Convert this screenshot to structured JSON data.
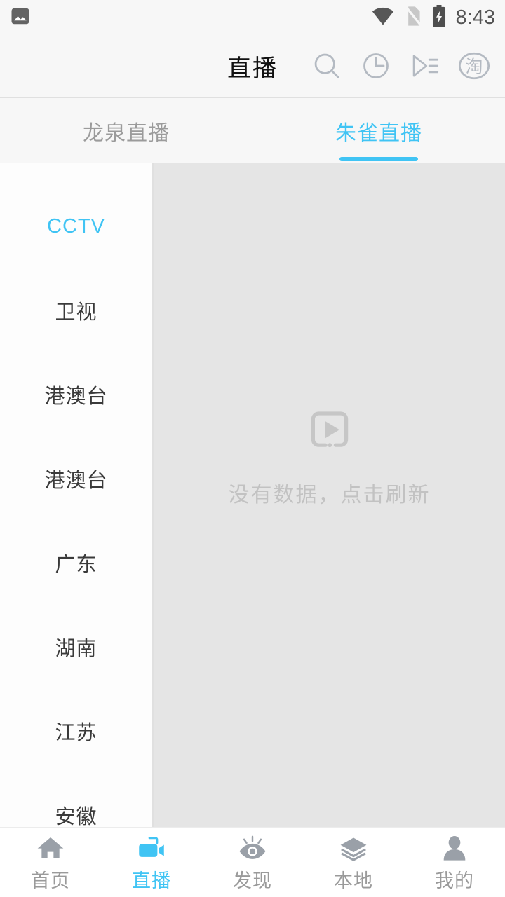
{
  "statusbar": {
    "notification_icon": "image-icon",
    "wifi_icon": "wifi-icon",
    "sim_icon": "no-sim-icon",
    "battery_icon": "battery-charging-icon",
    "time": "8:43"
  },
  "titlebar": {
    "title": "直播",
    "actions": [
      {
        "name": "search-icon",
        "label": "搜索"
      },
      {
        "name": "history-clock-icon",
        "label": "历史"
      },
      {
        "name": "playlist-icon",
        "label": "播放列表"
      },
      {
        "name": "taobao-icon",
        "label": "淘"
      }
    ]
  },
  "tabs": [
    {
      "label": "龙泉直播",
      "active": false
    },
    {
      "label": "朱雀直播",
      "active": true
    }
  ],
  "sidebar": {
    "items": [
      {
        "label": "CCTV",
        "active": true
      },
      {
        "label": "卫视",
        "active": false
      },
      {
        "label": "港澳台",
        "active": false
      },
      {
        "label": "港澳台",
        "active": false
      },
      {
        "label": "广东",
        "active": false
      },
      {
        "label": "湖南",
        "active": false
      },
      {
        "label": "江苏",
        "active": false
      },
      {
        "label": "安徽",
        "active": false
      }
    ]
  },
  "content": {
    "empty_icon": "video-placeholder-icon",
    "empty_text": "没有数据，点击刷新"
  },
  "bottomnav": {
    "items": [
      {
        "label": "首页",
        "icon": "home-icon",
        "active": false
      },
      {
        "label": "直播",
        "icon": "video-camera-icon",
        "active": true
      },
      {
        "label": "发现",
        "icon": "eye-discover-icon",
        "active": false
      },
      {
        "label": "本地",
        "icon": "layers-icon",
        "active": false
      },
      {
        "label": "我的",
        "icon": "person-icon",
        "active": false
      }
    ]
  },
  "colors": {
    "accent": "#40c4f4",
    "inactive_text": "#9a9a9a",
    "content_bg": "#e5e5e5",
    "sidebar_bg": "#fdfdfd",
    "header_bg": "#f7f7f7"
  }
}
